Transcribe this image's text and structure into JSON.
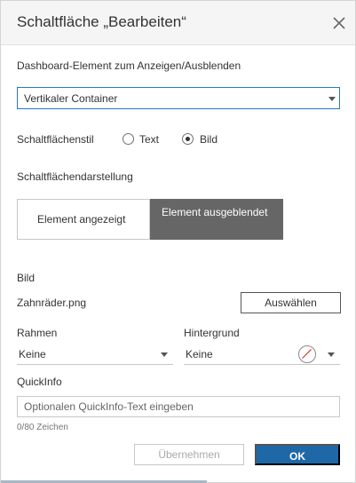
{
  "dialog": {
    "title": "Schaltfläche „Bearbeiten“",
    "close_icon": "close-icon"
  },
  "element_section": {
    "label": "Dashboard-Element zum Anzeigen/Ausblenden",
    "selected_value": "Vertikaler Container"
  },
  "button_style": {
    "label": "Schaltflächenstil",
    "options": [
      {
        "label": "Text",
        "selected": false
      },
      {
        "label": "Bild",
        "selected": true
      }
    ]
  },
  "appearance": {
    "label": "Schaltflächendarstellung",
    "segments": [
      {
        "label": "Element angezeigt",
        "active": false
      },
      {
        "label": "Element ausgeblendet",
        "active": true
      }
    ]
  },
  "image": {
    "label": "Bild",
    "filename": "Zahnräder.png",
    "choose_button": "Auswählen"
  },
  "border": {
    "label": "Rahmen",
    "value": "Keine"
  },
  "background": {
    "label": "Hintergrund",
    "value": "Keine"
  },
  "tooltip": {
    "label": "QuickInfo",
    "placeholder": "Optionalen QuickInfo-Text eingeben",
    "value": "",
    "counter": "0/80 Zeichen"
  },
  "footer": {
    "apply_button": "Übernehmen",
    "ok_button": "OK"
  },
  "colors": {
    "accent": "#1f68a7",
    "focus_border": "#2a78c8",
    "active_segment": "#666666",
    "header_bg": "#f5f5f5"
  }
}
